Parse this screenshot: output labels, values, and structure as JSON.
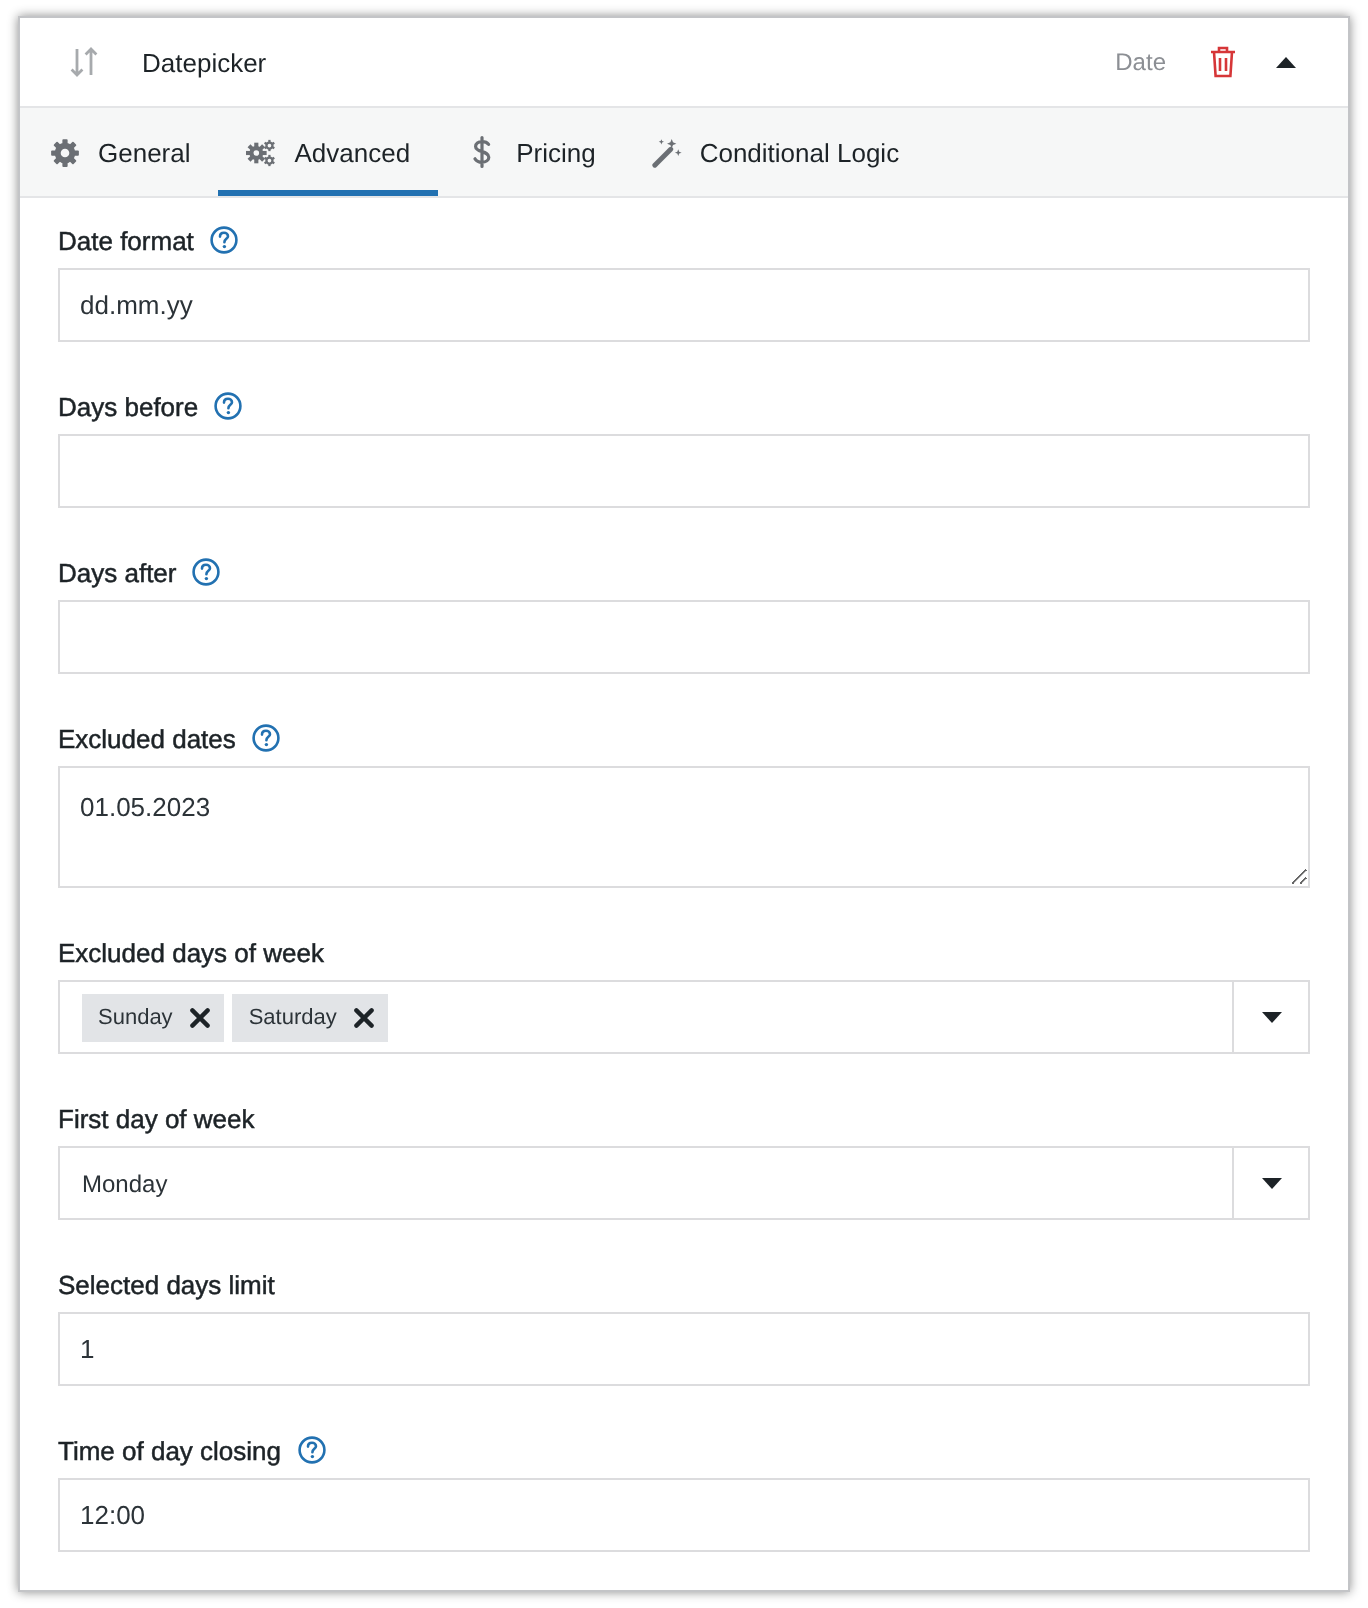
{
  "header": {
    "title": "Datepicker",
    "type": "Date"
  },
  "tabs": [
    {
      "label": "General",
      "selected": false
    },
    {
      "label": "Advanced",
      "selected": true
    },
    {
      "label": "Pricing",
      "selected": false
    },
    {
      "label": "Conditional Logic",
      "selected": false
    }
  ],
  "fields": [
    {
      "kind": "text",
      "label": "Date format",
      "help": true,
      "value": "dd.mm.yy"
    },
    {
      "kind": "text",
      "label": "Days before",
      "help": true
    },
    {
      "kind": "text",
      "label": "Days after",
      "help": true
    },
    {
      "kind": "textarea",
      "label": "Excluded dates",
      "help": true,
      "value": "01.05.2023"
    },
    {
      "kind": "multiselect",
      "label": "Excluded days of week",
      "help": false,
      "tags": [
        "Sunday",
        "Saturday"
      ]
    },
    {
      "kind": "select",
      "label": "First day of week",
      "help": false,
      "value": "Monday"
    },
    {
      "kind": "text",
      "label": "Selected days limit",
      "help": false,
      "value": "1"
    },
    {
      "kind": "text",
      "label": "Time of day closing",
      "help": true,
      "value": "12:00"
    }
  ]
}
